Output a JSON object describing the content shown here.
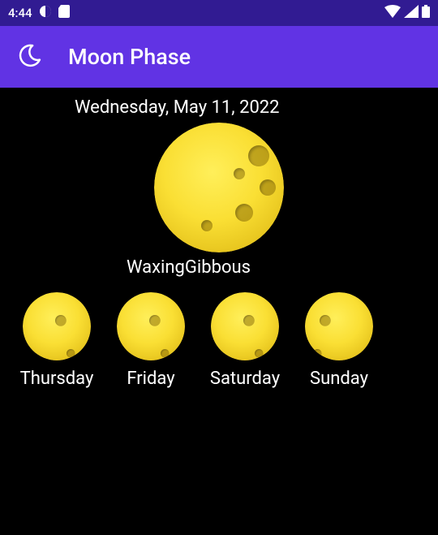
{
  "status": {
    "time": "4:44",
    "icons_left": [
      "contrast-icon",
      "sd-card-icon"
    ],
    "icons_right": [
      "wifi-icon",
      "signal-icon",
      "battery-icon"
    ]
  },
  "app_bar": {
    "icon": "moon-icon",
    "title": "Moon Phase"
  },
  "main": {
    "date": "Wednesday, May 11, 2022",
    "phase_key": "waxing-gibbous",
    "phase_label": "WaxingGibbous"
  },
  "forecast": [
    {
      "day": "Thursday",
      "phase_key": "waxing-gibbous"
    },
    {
      "day": "Friday",
      "phase_key": "waxing-gibbous"
    },
    {
      "day": "Saturday",
      "phase_key": "full"
    },
    {
      "day": "Sunday",
      "phase_key": "waning-gibbous"
    }
  ]
}
